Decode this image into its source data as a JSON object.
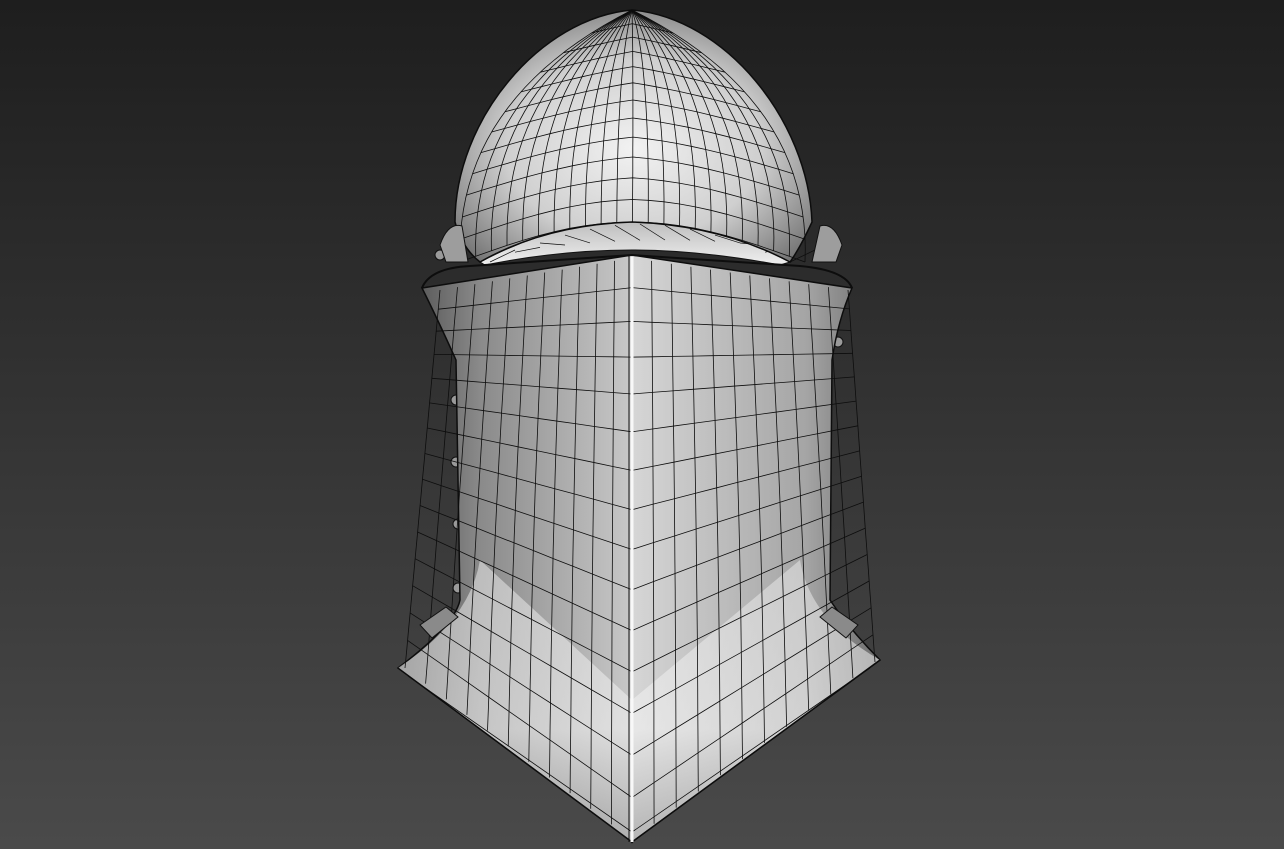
{
  "scene": {
    "subject_icon": "helmet-icon",
    "render_style": "shaded-wireframe",
    "colors": {
      "background_top": "#1e1e1e",
      "background_bottom": "#4a4a4a",
      "surface_light": "#f2f2f2",
      "surface_mid": "#a8a8a8",
      "surface_dark": "#4a4a4a",
      "wire": "#0d0d0d"
    }
  }
}
